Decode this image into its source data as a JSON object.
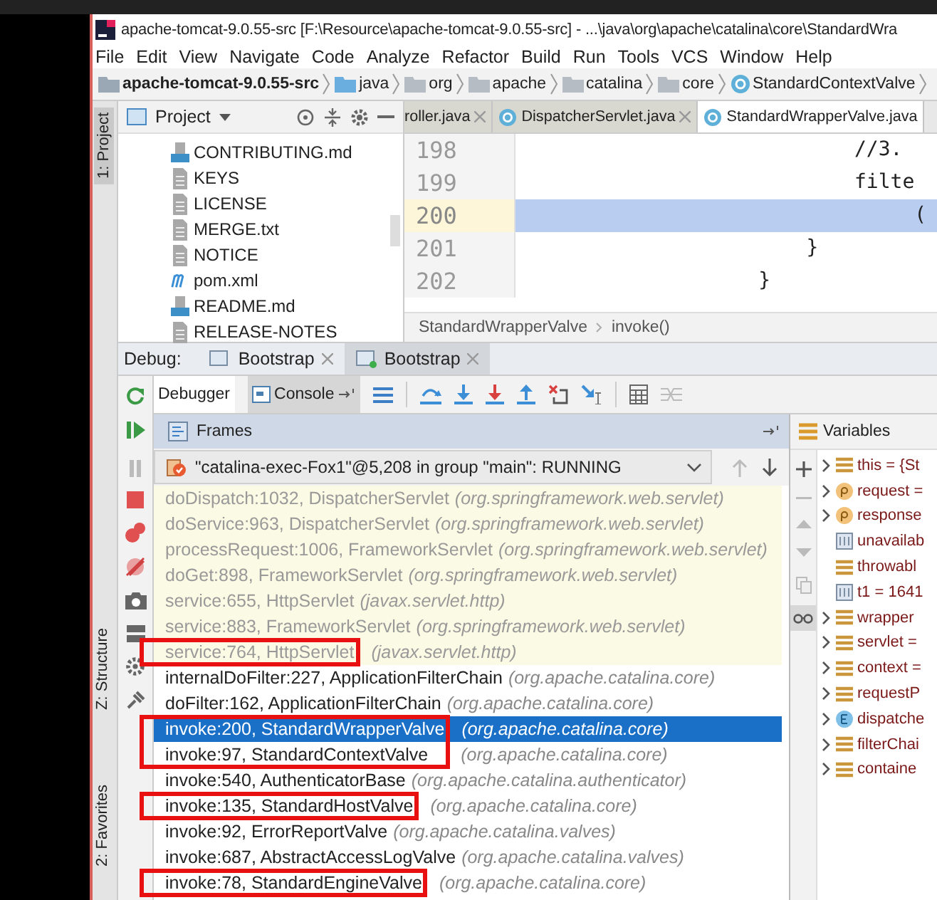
{
  "window": {
    "title": "apache-tomcat-9.0.55-src [F:\\Resource\\apache-tomcat-9.0.55-src] - ...\\java\\org\\apache\\catalina\\core\\StandardWra"
  },
  "menu": [
    "File",
    "Edit",
    "View",
    "Navigate",
    "Code",
    "Analyze",
    "Refactor",
    "Build",
    "Run",
    "Tools",
    "VCS",
    "Window",
    "Help"
  ],
  "breadcrumb": [
    {
      "label": "apache-tomcat-9.0.55-src",
      "kind": "project"
    },
    {
      "label": "java",
      "kind": "source"
    },
    {
      "label": "org",
      "kind": "folder"
    },
    {
      "label": "apache",
      "kind": "folder"
    },
    {
      "label": "catalina",
      "kind": "folder"
    },
    {
      "label": "core",
      "kind": "folder"
    },
    {
      "label": "StandardContextValve",
      "kind": "class"
    }
  ],
  "tool_strip": [
    {
      "label": "1: Project",
      "selected": true
    },
    {
      "label": "Z: Structure",
      "selected": false
    },
    {
      "label": "2: Favorites",
      "selected": false
    }
  ],
  "project": {
    "title": "Project",
    "items": [
      {
        "name": "CONTRIBUTING.md",
        "kind": "md"
      },
      {
        "name": "KEYS",
        "kind": "text"
      },
      {
        "name": "LICENSE",
        "kind": "text"
      },
      {
        "name": "MERGE.txt",
        "kind": "text"
      },
      {
        "name": "NOTICE",
        "kind": "text"
      },
      {
        "name": "pom.xml",
        "kind": "maven"
      },
      {
        "name": "README.md",
        "kind": "md"
      },
      {
        "name": "RELEASE-NOTES",
        "kind": "text"
      }
    ]
  },
  "editor": {
    "tabs": [
      {
        "label": "roller.java",
        "closable": true,
        "selected": false
      },
      {
        "label": "DispatcherServlet.java",
        "closable": true,
        "selected": false
      },
      {
        "label": "StandardWrapperValve.java",
        "closable": false,
        "selected": true
      }
    ],
    "lines": [
      {
        "number": "198",
        "code": "                            //3.",
        "current": false
      },
      {
        "number": "199",
        "code": "                            filte",
        "current": false
      },
      {
        "number": "200",
        "code": "                                 (",
        "current": true
      },
      {
        "number": "201",
        "code": "                        }",
        "current": false
      },
      {
        "number": "202",
        "code": "                    }",
        "current": false
      }
    ],
    "path": [
      "StandardWrapperValve",
      "invoke()"
    ]
  },
  "debug": {
    "label": "Debug:",
    "tabs": [
      {
        "label": "Bootstrap",
        "selected": false
      },
      {
        "label": "Bootstrap",
        "selected": true
      }
    ],
    "subtabs": [
      {
        "label": "Debugger",
        "selected": true
      },
      {
        "label": "Console",
        "selected": false
      }
    ],
    "frames_title": "Frames",
    "thread": "\"catalina-exec-Fox1\"@5,208 in group \"main\": RUNNING",
    "frames": [
      {
        "method": "doDispatch:1032, DispatcherServlet",
        "package": "(org.springframework.web.servlet)",
        "library": true,
        "selected": false,
        "marked": false
      },
      {
        "method": "doService:963, DispatcherServlet",
        "package": "(org.springframework.web.servlet)",
        "library": true,
        "selected": false,
        "marked": false
      },
      {
        "method": "processRequest:1006, FrameworkServlet",
        "package": "(org.springframework.web.servlet)",
        "library": true,
        "selected": false,
        "marked": false
      },
      {
        "method": "doGet:898, FrameworkServlet",
        "package": "(org.springframework.web.servlet)",
        "library": true,
        "selected": false,
        "marked": false
      },
      {
        "method": "service:655, HttpServlet",
        "package": "(javax.servlet.http)",
        "library": true,
        "selected": false,
        "marked": false
      },
      {
        "method": "service:883, FrameworkServlet",
        "package": "(org.springframework.web.servlet)",
        "library": true,
        "selected": false,
        "marked": false
      },
      {
        "method": "service:764, HttpServlet",
        "package": "(javax.servlet.http)",
        "library": true,
        "selected": false,
        "marked": true
      },
      {
        "method": "internalDoFilter:227, ApplicationFilterChain",
        "package": "(org.apache.catalina.core)",
        "library": false,
        "selected": false,
        "marked": false
      },
      {
        "method": "doFilter:162, ApplicationFilterChain",
        "package": "(org.apache.catalina.core)",
        "library": false,
        "selected": false,
        "marked": false
      },
      {
        "method": "invoke:200, StandardWrapperValve",
        "package": "(org.apache.catalina.core)",
        "library": false,
        "selected": true,
        "marked": true
      },
      {
        "method": "invoke:97, StandardContextValve",
        "package": "(org.apache.catalina.core)",
        "library": false,
        "selected": false,
        "marked": true
      },
      {
        "method": "invoke:540, AuthenticatorBase",
        "package": "(org.apache.catalina.authenticator)",
        "library": false,
        "selected": false,
        "marked": false
      },
      {
        "method": "invoke:135, StandardHostValve",
        "package": "(org.apache.catalina.core)",
        "library": false,
        "selected": false,
        "marked": true
      },
      {
        "method": "invoke:92, ErrorReportValve",
        "package": "(org.apache.catalina.valves)",
        "library": false,
        "selected": false,
        "marked": false
      },
      {
        "method": "invoke:687, AbstractAccessLogValve",
        "package": "(org.apache.catalina.valves)",
        "library": false,
        "selected": false,
        "marked": false
      },
      {
        "method": "invoke:78, StandardEngineValve",
        "package": "(org.apache.catalina.core)",
        "library": false,
        "selected": false,
        "marked": true
      }
    ],
    "variables_title": "Variables",
    "variables": [
      {
        "text": "this = {St",
        "kind": "field",
        "expandable": true
      },
      {
        "text": "request =",
        "kind": "param",
        "expandable": true
      },
      {
        "text": "response",
        "kind": "param",
        "expandable": true
      },
      {
        "text": "unavailab",
        "kind": "local",
        "expandable": false
      },
      {
        "text": "throwabl",
        "kind": "field",
        "expandable": false
      },
      {
        "text": "t1 = 1641",
        "kind": "local",
        "expandable": false
      },
      {
        "text": "wrapper",
        "kind": "field",
        "expandable": true
      },
      {
        "text": "servlet =",
        "kind": "field",
        "expandable": true
      },
      {
        "text": "context =",
        "kind": "field",
        "expandable": true
      },
      {
        "text": "requestP",
        "kind": "field",
        "expandable": true
      },
      {
        "text": "dispatche",
        "kind": "enum",
        "expandable": true
      },
      {
        "text": "filterChai",
        "kind": "field",
        "expandable": true
      },
      {
        "text": "containe",
        "kind": "field",
        "expandable": true
      }
    ]
  }
}
